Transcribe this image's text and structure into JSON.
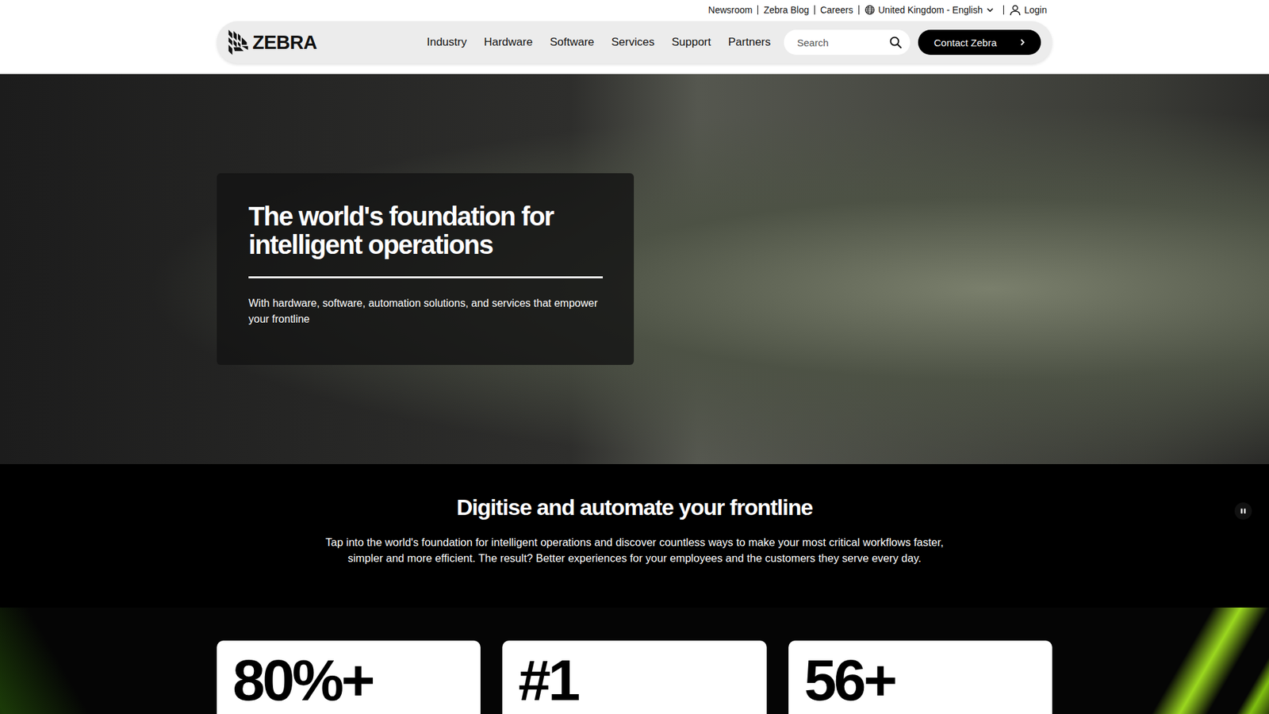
{
  "utility_bar": {
    "links": [
      "Newsroom",
      "Zebra Blog",
      "Careers"
    ],
    "region": "United Kingdom - English",
    "login": "Login"
  },
  "header": {
    "logo": "ZEBRA",
    "nav": [
      "Industry",
      "Hardware",
      "Software",
      "Services",
      "Support",
      "Partners"
    ],
    "search": {
      "placeholder": "Search"
    },
    "contact_button": "Contact Zebra"
  },
  "hero": {
    "title": "The world's foundation for intelligent operations",
    "subtitle": "With hardware, software, automation solutions, and services that empower your frontline",
    "video_playing": true
  },
  "intro": {
    "title": "Digitise and automate your frontline",
    "text": "Tap into the world's foundation for intelligent operations and discover countless ways to make your most critical workflows faster, simpler and more efficient.  The result?  Better experiences for your employees and the customers they serve every day."
  },
  "stats": [
    {
      "value": "80%+"
    },
    {
      "value": "#1"
    },
    {
      "value": "56+"
    }
  ]
}
